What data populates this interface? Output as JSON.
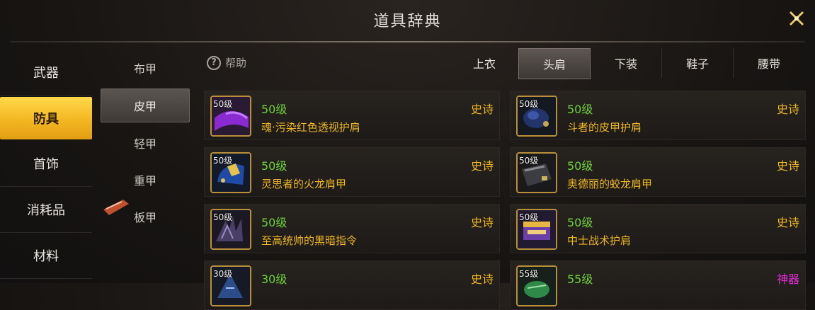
{
  "title": "道具辞典",
  "help_label": "帮助",
  "categories": [
    {
      "label": "武器"
    },
    {
      "label": "防具"
    },
    {
      "label": "首饰"
    },
    {
      "label": "消耗品"
    },
    {
      "label": "材料"
    }
  ],
  "active_category": "防具",
  "subcategories": [
    {
      "label": "布甲"
    },
    {
      "label": "皮甲"
    },
    {
      "label": "轻甲"
    },
    {
      "label": "重甲"
    },
    {
      "label": "板甲"
    }
  ],
  "active_subcategory": "皮甲",
  "slot_tabs": [
    {
      "label": "上衣"
    },
    {
      "label": "头肩"
    },
    {
      "label": "下装"
    },
    {
      "label": "鞋子"
    },
    {
      "label": "腰带"
    }
  ],
  "active_slot_tab": "头肩",
  "items": [
    {
      "badge": "50级",
      "level": "50级",
      "name": "魂·污染红色透视护肩",
      "rarity": "史诗",
      "icon": "purple-shoulder-icon"
    },
    {
      "badge": "50级",
      "level": "50级",
      "name": "斗者的皮甲护肩",
      "rarity": "史诗",
      "icon": "blue-shoulder-icon"
    },
    {
      "badge": "50级",
      "level": "50级",
      "name": "灵思者的火龙肩甲",
      "rarity": "史诗",
      "icon": "blue-gold-shoulder-icon"
    },
    {
      "badge": "50级",
      "level": "50级",
      "name": "奥德丽的蛟龙肩甲",
      "rarity": "史诗",
      "icon": "gray-shoulder-icon"
    },
    {
      "badge": "50级",
      "level": "50级",
      "name": "至高统帅的黑暗指令",
      "rarity": "史诗",
      "icon": "dark-claw-shoulder-icon"
    },
    {
      "badge": "50级",
      "level": "50级",
      "name": "中士战术护肩",
      "rarity": "史诗",
      "icon": "gold-box-shoulder-icon"
    },
    {
      "badge": "30级",
      "level": "30级",
      "name": "",
      "rarity": "史诗",
      "icon": "blue-spike-shoulder-icon"
    },
    {
      "badge": "55级",
      "level": "55级",
      "name": "",
      "rarity": "神器",
      "icon": "green-shoulder-icon"
    }
  ],
  "colors": {
    "active_category": "#f4b623",
    "level_text": "#6ed23a",
    "name_text": "#f0b824",
    "epic": "#f0b824",
    "artifact": "#e32bd6"
  }
}
